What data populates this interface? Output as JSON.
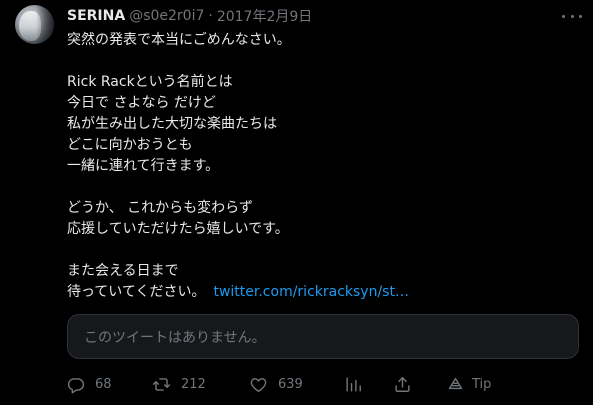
{
  "tweet": {
    "display_name": "SERINA",
    "handle": "@s0e2r0i7",
    "separator": "·",
    "date": "2017年2月9日",
    "body": {
      "paragraph1": [
        "突然の発表で本当にごめんなさい。"
      ],
      "paragraph2": [
        "Rick Rackという名前とは",
        "今日で さよなら だけど",
        "私が生み出した大切な楽曲たちは",
        "どこに向かおうとも",
        "一緒に連れて行きます。"
      ],
      "paragraph3": [
        "どうか、 これからも変わらず",
        "応援していただけたら嬉しいです。"
      ],
      "paragraph4_line1": "また会える日まで",
      "paragraph4_line2": "待っていてください。",
      "link": "twitter.com/rickracksyn/st…"
    },
    "quote_unavailable": "このツイートはありません。"
  },
  "actions": {
    "reply_count": "68",
    "retweet_count": "212",
    "like_count": "639",
    "tip_label": "Tip"
  },
  "icons": {
    "more": "more-horizontal-icon",
    "reply": "reply-icon",
    "retweet": "retweet-icon",
    "like": "heart-icon",
    "views": "analytics-icon",
    "share": "share-icon",
    "tip": "tip-icon"
  },
  "colors": {
    "background": "#000000",
    "text": "#e7e9ea",
    "secondary": "#71767b",
    "link": "#1d9bf0",
    "border": "#2f3336"
  }
}
